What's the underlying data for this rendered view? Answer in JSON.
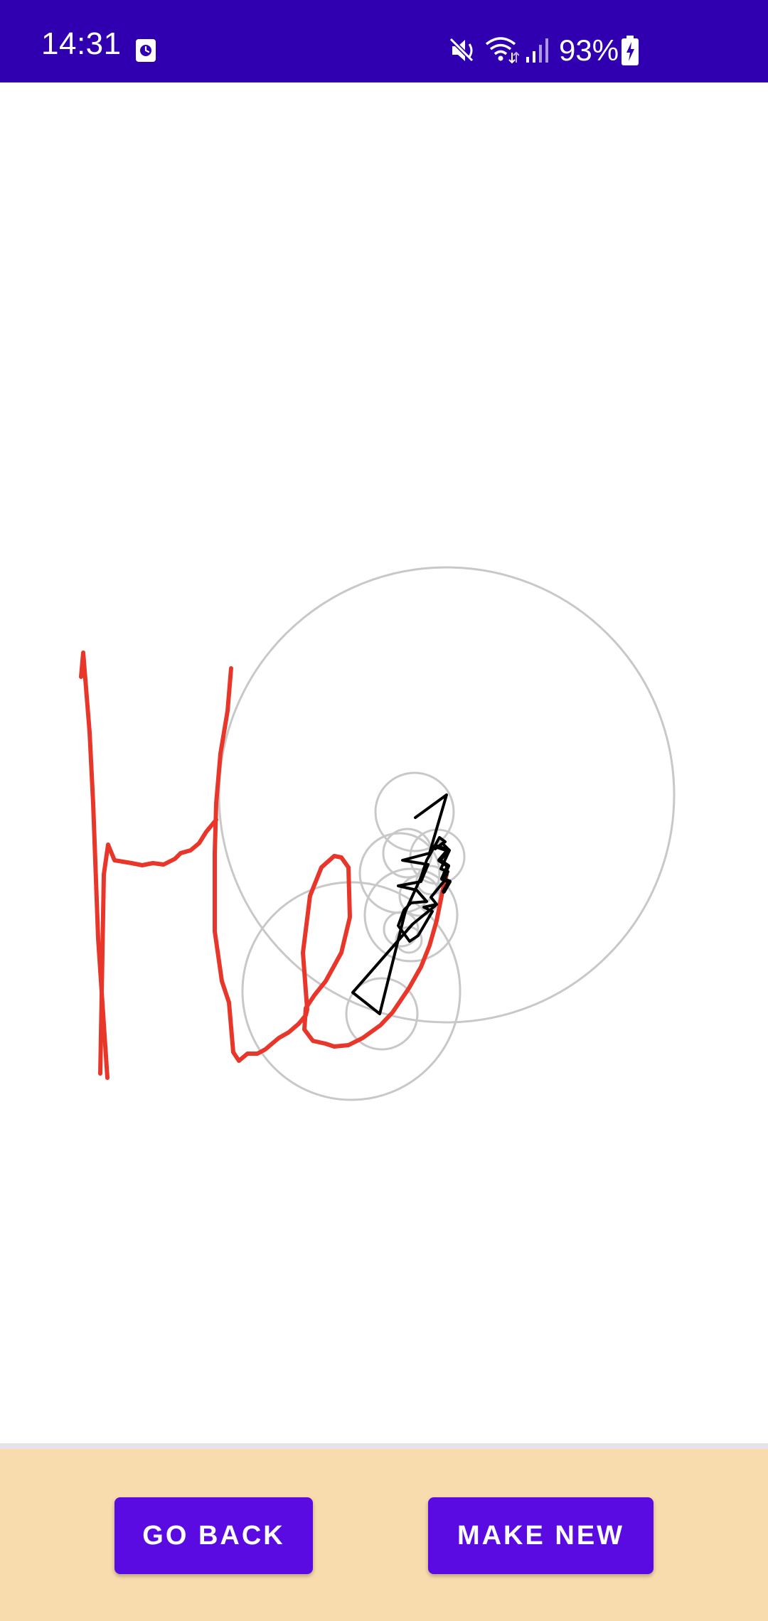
{
  "status_bar": {
    "time": "14:31",
    "battery_percent": "93%",
    "icons": [
      "alarm-icon",
      "mute-icon",
      "wifi-icon",
      "signal-icon",
      "battery-charging-icon"
    ],
    "background_color": "#3000b0"
  },
  "drawing": {
    "stroke_color": "#e8362a",
    "trace_color": "#000000",
    "circle_color": "#c8c8c8"
  },
  "bottom_panel": {
    "background_color": "#f9dcae",
    "go_back_label": "GO BACK",
    "make_new_label": "MAKE NEW",
    "button_color": "#5a0be2"
  }
}
